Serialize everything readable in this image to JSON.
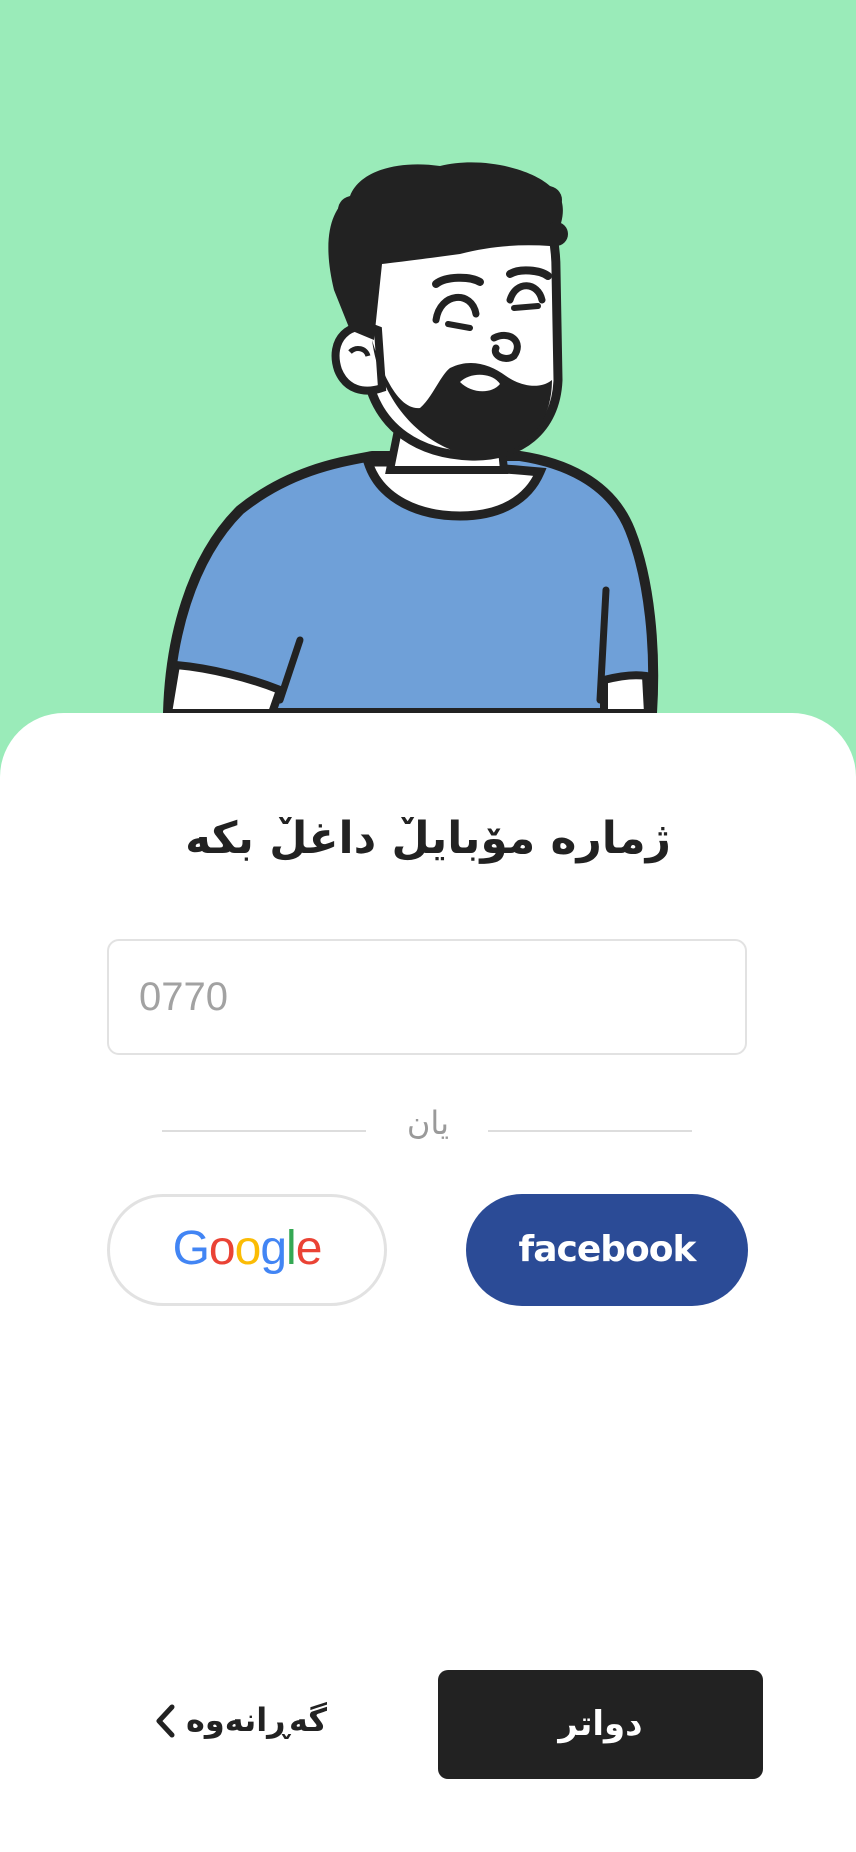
{
  "illustration": {
    "icon": "smiling-bearded-man-illustration",
    "background_color": "#9aebb9",
    "shirt_color": "#6fa0d8"
  },
  "title": "ژمارە مۆبایلٚ داغلٚ بکە",
  "phone": {
    "placeholder": "0770",
    "value": ""
  },
  "divider_text": "یان",
  "google": {
    "icon": "google-logo",
    "letters": [
      "G",
      "o",
      "o",
      "g",
      "l",
      "e"
    ],
    "colors": [
      "#4285f4",
      "#ea4335",
      "#fbbc05",
      "#4285f4",
      "#34a853",
      "#ea4335"
    ]
  },
  "facebook": {
    "icon": "facebook-logo",
    "label": "facebook",
    "color": "#2b4b96"
  },
  "footer": {
    "back_label": "گەڕانەوە",
    "back_icon": "chevron-left-icon",
    "next_label": "دواتر"
  }
}
